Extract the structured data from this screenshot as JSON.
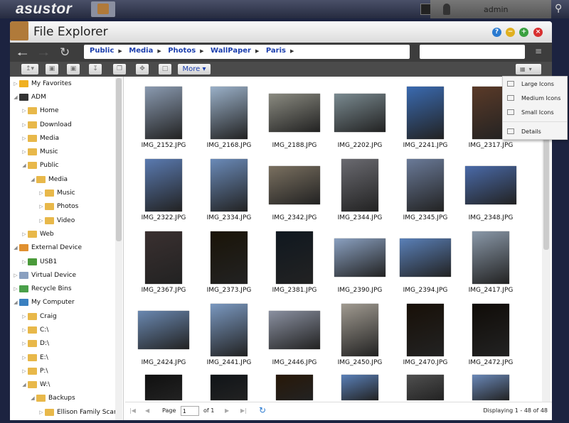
{
  "topbar": {
    "logo": "asustor",
    "user": "admin"
  },
  "window": {
    "title": "File Explorer"
  },
  "nav": {
    "breadcrumb": [
      "Public",
      "Media",
      "Photos",
      "WallPaper",
      "Paris"
    ],
    "filter_value": ""
  },
  "toolbar": {
    "more_label": "More"
  },
  "view_menu": {
    "items": [
      "Large Icons",
      "Medium Icons",
      "Small Icons",
      "Details"
    ]
  },
  "tree": [
    {
      "label": "My Favorites",
      "level": 0,
      "icon": "star-icon",
      "color": "#f0b020"
    },
    {
      "label": "ADM",
      "level": 0,
      "icon": "server-icon",
      "color": "#333333"
    },
    {
      "label": "Home",
      "level": 1,
      "icon": "folder-icon",
      "color": "#e8b84a"
    },
    {
      "label": "Download",
      "level": 1,
      "icon": "folder-icon",
      "color": "#e8b84a"
    },
    {
      "label": "Media",
      "level": 1,
      "icon": "folder-icon",
      "color": "#e8b84a"
    },
    {
      "label": "Music",
      "level": 1,
      "icon": "folder-icon",
      "color": "#e8b84a"
    },
    {
      "label": "Public",
      "level": 1,
      "icon": "folder-icon",
      "color": "#e8b84a"
    },
    {
      "label": "Media",
      "level": 2,
      "icon": "folder-icon",
      "color": "#e8b84a"
    },
    {
      "label": "Music",
      "level": 3,
      "icon": "folder-icon",
      "color": "#e8b84a"
    },
    {
      "label": "Photos",
      "level": 3,
      "icon": "folder-icon",
      "color": "#e8b84a"
    },
    {
      "label": "Video",
      "level": 3,
      "icon": "folder-icon",
      "color": "#e8b84a"
    },
    {
      "label": "Web",
      "level": 1,
      "icon": "folder-icon",
      "color": "#e8b84a"
    },
    {
      "label": "External Device",
      "level": 0,
      "icon": "external-drive-icon",
      "color": "#e09030"
    },
    {
      "label": "USB1",
      "level": 1,
      "icon": "usb-icon",
      "color": "#4a9a3a"
    },
    {
      "label": "Virtual Device",
      "level": 0,
      "icon": "virtual-device-icon",
      "color": "#8aa0c0"
    },
    {
      "label": "Recycle Bins",
      "level": 0,
      "icon": "recycle-icon",
      "color": "#4aa04a"
    },
    {
      "label": "My Computer",
      "level": 0,
      "icon": "computer-icon",
      "color": "#3a80c0"
    },
    {
      "label": "Craig",
      "level": 1,
      "icon": "folder-icon",
      "color": "#e8b84a"
    },
    {
      "label": "C:\\",
      "level": 1,
      "icon": "folder-icon",
      "color": "#e8b84a"
    },
    {
      "label": "D:\\",
      "level": 1,
      "icon": "folder-icon",
      "color": "#e8b84a"
    },
    {
      "label": "E:\\",
      "level": 1,
      "icon": "folder-icon",
      "color": "#e8b84a"
    },
    {
      "label": "P:\\",
      "level": 1,
      "icon": "folder-icon",
      "color": "#e8b84a"
    },
    {
      "label": "W:\\",
      "level": 1,
      "icon": "folder-icon",
      "color": "#e8b84a"
    },
    {
      "label": "Backups",
      "level": 2,
      "icon": "folder-icon",
      "color": "#e8b84a"
    },
    {
      "label": "Ellison Family Scan",
      "level": 3,
      "icon": "folder-icon",
      "color": "#e8b84a"
    }
  ],
  "files": [
    {
      "name": "IMG_2152.JPG",
      "orientation": "portrait",
      "color": "#8a9ab0"
    },
    {
      "name": "IMG_2168.JPG",
      "orientation": "portrait",
      "color": "#9ab0c8"
    },
    {
      "name": "IMG_2188.JPG",
      "orientation": "landscape",
      "color": "#8a8a80"
    },
    {
      "name": "IMG_2202.JPG",
      "orientation": "landscape",
      "color": "#7a8a90"
    },
    {
      "name": "IMG_2241.JPG",
      "orientation": "portrait",
      "color": "#3a6ab0"
    },
    {
      "name": "IMG_2317.JPG",
      "orientation": "portrait",
      "color": "#5a3a28"
    },
    {
      "name": "IMG_2322.JPG",
      "orientation": "portrait",
      "color": "#5a7ab0"
    },
    {
      "name": "IMG_2334.JPG",
      "orientation": "portrait",
      "color": "#6a8ab8"
    },
    {
      "name": "IMG_2342.JPG",
      "orientation": "landscape",
      "color": "#7a7060"
    },
    {
      "name": "IMG_2344.JPG",
      "orientation": "portrait",
      "color": "#6a6a70"
    },
    {
      "name": "IMG_2345.JPG",
      "orientation": "portrait",
      "color": "#6a7a98"
    },
    {
      "name": "IMG_2348.JPG",
      "orientation": "landscape",
      "color": "#4a6aa8"
    },
    {
      "name": "IMG_2367.JPG",
      "orientation": "portrait",
      "color": "#3a3030"
    },
    {
      "name": "IMG_2373.JPG",
      "orientation": "portrait",
      "color": "#1a1408"
    },
    {
      "name": "IMG_2381.JPG",
      "orientation": "portrait",
      "color": "#101820"
    },
    {
      "name": "IMG_2390.JPG",
      "orientation": "landscape",
      "color": "#8aa0c0"
    },
    {
      "name": "IMG_2394.JPG",
      "orientation": "landscape",
      "color": "#5a80b8"
    },
    {
      "name": "IMG_2417.JPG",
      "orientation": "portrait",
      "color": "#8a98a8"
    },
    {
      "name": "IMG_2424.JPG",
      "orientation": "landscape",
      "color": "#6a88b0"
    },
    {
      "name": "IMG_2441.JPG",
      "orientation": "portrait",
      "color": "#7a98c0"
    },
    {
      "name": "IMG_2446.JPG",
      "orientation": "landscape",
      "color": "#8a90a0"
    },
    {
      "name": "IMG_2450.JPG",
      "orientation": "portrait",
      "color": "#a09a90"
    },
    {
      "name": "IMG_2470.JPG",
      "orientation": "portrait",
      "color": "#181008"
    },
    {
      "name": "IMG_2472.JPG",
      "orientation": "portrait",
      "color": "#100c08"
    },
    {
      "name": "",
      "orientation": "portrait",
      "color": "#101010"
    },
    {
      "name": "",
      "orientation": "portrait",
      "color": "#101418"
    },
    {
      "name": "",
      "orientation": "portrait",
      "color": "#281808"
    },
    {
      "name": "",
      "orientation": "portrait",
      "color": "#5a80b8"
    },
    {
      "name": "",
      "orientation": "portrait",
      "color": "#505050"
    },
    {
      "name": "",
      "orientation": "portrait",
      "color": "#6a88b8"
    }
  ],
  "pager": {
    "page_label": "Page",
    "page": "1",
    "of_label": "of 1",
    "status": "Displaying 1 - 48 of 48"
  }
}
